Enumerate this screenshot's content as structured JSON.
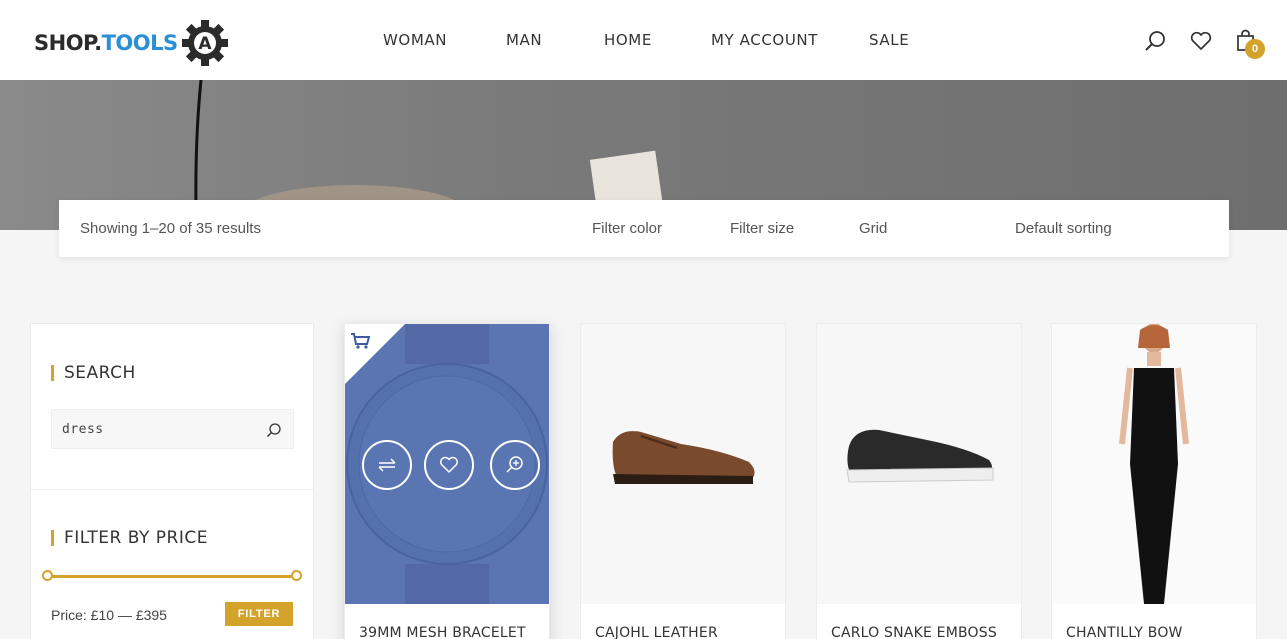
{
  "brand": {
    "logo_main": "SHOP.",
    "logo_accent": "TOOLS",
    "logo_letter": "A"
  },
  "nav": {
    "items": [
      {
        "label": "WOMAN"
      },
      {
        "label": "MAN"
      },
      {
        "label": "HOME"
      },
      {
        "label": "MY ACCOUNT"
      },
      {
        "label": "SALE"
      }
    ]
  },
  "header_icons": {
    "search": "search-icon",
    "wishlist": "heart-icon",
    "cart": "shopping-bag-icon",
    "cart_count": "0"
  },
  "toolbar": {
    "results": "Showing 1–20 of 35 results",
    "filter_color": "Filter color",
    "filter_size": "Filter size",
    "view": "Grid",
    "sorting": "Default sorting"
  },
  "sidebar": {
    "search_title": "SEARCH",
    "search_value": "dress",
    "price_title": "FILTER BY PRICE",
    "price_label": "Price: £10 — £395",
    "filter_button": "FILTER"
  },
  "products": [
    {
      "name": "39MM MESH BRACELET",
      "image": "watch"
    },
    {
      "name": "CAJOHL LEATHER",
      "image": "brown-brogue-shoe"
    },
    {
      "name": "CARLO SNAKE EMBOSS",
      "image": "black-sneaker"
    },
    {
      "name": "CHANTILLY BOW",
      "image": "black-dress"
    }
  ],
  "colors": {
    "accent": "#d4a32c",
    "brand_blue": "#2a8fd6",
    "overlay_blue": "#5b75b3"
  }
}
